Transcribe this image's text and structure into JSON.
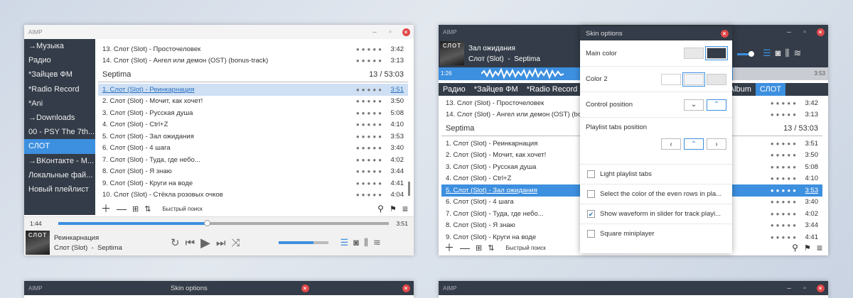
{
  "w1": {
    "title": "AIMP",
    "sidebar": [
      "→Музыка",
      "Радио",
      "*Зайцев ФМ",
      "*Radio Record",
      "*Ani",
      "→Downloads",
      "00 - PSY The 7th...",
      "СЛОТ",
      "→ВКонтакте - М...",
      "Локальные фай...",
      "Новый плейлист"
    ],
    "top_tracks": [
      {
        "title": "13. Слот (Slot) - Просточеловек",
        "dur": "3:42"
      },
      {
        "title": "14. Слот (Slot) - Ангел или демон (OST) (bonus-track)",
        "dur": "3:13"
      }
    ],
    "group": {
      "name": "Septima",
      "info": "13 / 53:03"
    },
    "tracks": [
      {
        "title": "1. Слот (Slot) - Реинкарнация",
        "dur": "3:51"
      },
      {
        "title": "2. Слот (Slot) - Мочит, как хочет!",
        "dur": "3:50"
      },
      {
        "title": "3. Слот (Slot) - Русская душа",
        "dur": "5:08"
      },
      {
        "title": "4. Слот (Slot) - Ctrl+Z",
        "dur": "4:10"
      },
      {
        "title": "5. Слот (Slot) - Зал ожидания",
        "dur": "3:53"
      },
      {
        "title": "6. Слот (Slot) - 4 шага",
        "dur": "3:40"
      },
      {
        "title": "7. Слот (Slot) - Туда, где небо...",
        "dur": "4:02"
      },
      {
        "title": "8. Слот (Slot) - Я знаю",
        "dur": "3:44"
      },
      {
        "title": "9. Слот (Slot) - Круги на воде",
        "dur": "4:41"
      },
      {
        "title": "10. Слот (Slot) - Стёкла розовых очков",
        "dur": "4:04"
      }
    ],
    "search": "Быстрый поиск",
    "time_left": "1:44",
    "time_right": "3:51",
    "seek_progress": 0.45,
    "now_title": "Реинкарнация",
    "now_artist": "Слот (Slot)",
    "now_album": "Septima",
    "cover_text": "СЛОТ",
    "volume": 0.7
  },
  "w2": {
    "title": "AIMP",
    "now_title": "Зал ожидания",
    "now_artist": "Слот (Slot)",
    "now_album": "Septima",
    "t_left": "1:26",
    "t_right": "3:53",
    "cover_text": "СЛОТ",
    "tabs": [
      "Радио",
      "*Зайцев ФМ",
      "*Radio Record",
      "7th Album",
      "СЛОТ"
    ],
    "top_tracks": [
      {
        "title": "13. Слот (Slot) - Просточеловек",
        "dur": "3:42"
      },
      {
        "title": "14. Слот (Slot) - Ангел или демон (OST) (bonus-track)",
        "dur": "3:13"
      }
    ],
    "group": {
      "name": "Septima",
      "info": "13 / 53:03"
    },
    "tracks": [
      {
        "title": "1. Слот (Slot) - Реинкарнация",
        "dur": "3:51"
      },
      {
        "title": "2. Слот (Slot) - Мочит, как хочет!",
        "dur": "3:50"
      },
      {
        "title": "3. Слот (Slot) - Русская душа",
        "dur": "5:08"
      },
      {
        "title": "4. Слот (Slot) - Ctrl+Z",
        "dur": "4:10"
      },
      {
        "title": "5. Слот (Slot) - Зал ожидания",
        "dur": "3:53"
      },
      {
        "title": "6. Слот (Slot) - 4 шага",
        "dur": "3:40"
      },
      {
        "title": "7. Слот (Slot) - Туда, где небо...",
        "dur": "4:02"
      },
      {
        "title": "8. Слот (Slot) - Я знаю",
        "dur": "3:44"
      },
      {
        "title": "9. Слот (Slot) - Круги на воде",
        "dur": "4:41"
      }
    ],
    "search": "Быстрый поиск"
  },
  "skin": {
    "title": "Skin options",
    "main_color": "Main color",
    "color2": "Color 2",
    "control_position": "Control position",
    "tabs_position": "Playlist tabs position",
    "checks": [
      {
        "label": "Light playlist tabs",
        "checked": false
      },
      {
        "label": "Select the color of the even rows in pla...",
        "checked": false
      },
      {
        "label": "Show waveform in slider for track playi...",
        "checked": true
      },
      {
        "label": "Square miniplayer",
        "checked": false
      }
    ]
  },
  "w3": {
    "title": "AIMP",
    "skin_title": "Skin options"
  },
  "w4": {
    "title": "AIMP"
  },
  "colors": {
    "accent": "#3d8fdf",
    "dark": "#333c48",
    "close": "#e04848"
  }
}
